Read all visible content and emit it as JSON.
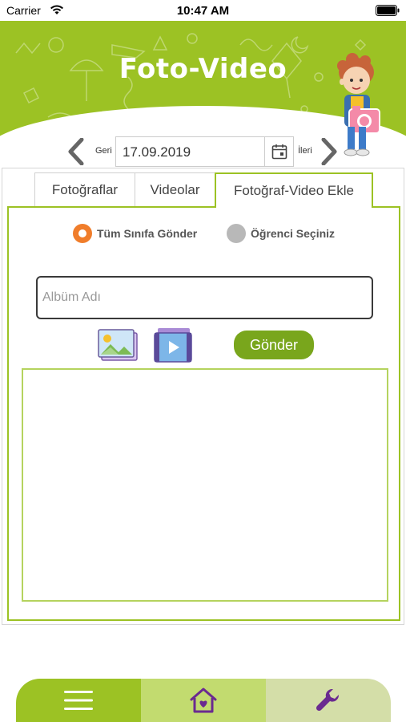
{
  "status_bar": {
    "carrier": "Carrier",
    "time": "10:47 AM",
    "icons": [
      "wifi-icon",
      "battery-icon"
    ]
  },
  "header": {
    "title": "Foto-Video",
    "background_color": "#9cc224",
    "illustration": "boy-holding-camera"
  },
  "date_nav": {
    "prev_label": "Geri",
    "date_value": "17.09.2019",
    "next_label": "İleri",
    "icons": [
      "chevron-left-icon",
      "calendar-icon",
      "chevron-right-icon"
    ]
  },
  "tabs": {
    "photos": "Fotoğraflar",
    "videos": "Videolar",
    "add": "Fotoğraf-Video Ekle",
    "active": "add"
  },
  "form": {
    "radio_all": "Tüm Sınıfa Gönder",
    "radio_student": "Öğrenci Seçiniz",
    "selected": "radio_all",
    "album_placeholder": "Albüm Adı",
    "album_value": "",
    "send_label": "Gönder",
    "icons": [
      "photo-gallery-icon",
      "video-gallery-icon"
    ]
  },
  "tabbar": {
    "items": [
      {
        "name": "menu",
        "icon": "hamburger-menu-icon"
      },
      {
        "name": "home",
        "icon": "home-heart-icon"
      },
      {
        "name": "settings",
        "icon": "wrench-icon"
      }
    ]
  },
  "colors": {
    "accent_green": "#9cc224",
    "button_green": "#79a61c",
    "radio_orange": "#f07d2b",
    "icon_purple": "#6a2a90"
  }
}
